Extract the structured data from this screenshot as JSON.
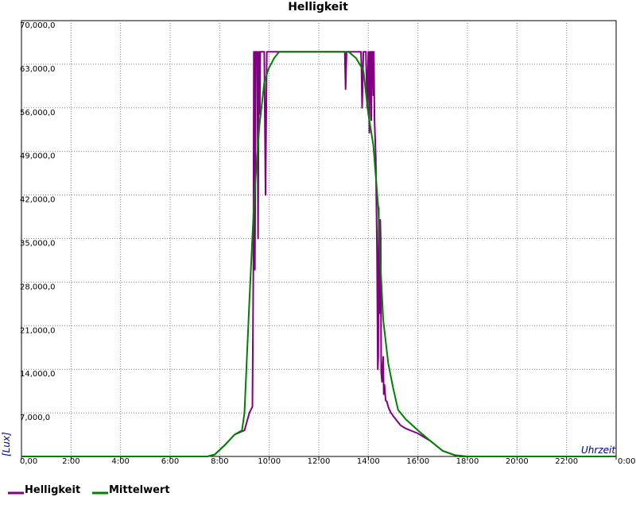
{
  "chart_data": {
    "type": "line",
    "title": "Helligkeit",
    "xlabel": "Uhrzeit",
    "ylabel": "[Lux]",
    "x_unit": "hours",
    "xlim": [
      0,
      24
    ],
    "ylim": [
      0,
      70000
    ],
    "x_ticks": [
      {
        "value": 0,
        "label": "0,00"
      },
      {
        "value": 2,
        "label": "2:00"
      },
      {
        "value": 4,
        "label": "4:00"
      },
      {
        "value": 6,
        "label": "6:00"
      },
      {
        "value": 8,
        "label": "8:00"
      },
      {
        "value": 10,
        "label": "10:00"
      },
      {
        "value": 12,
        "label": "12:00"
      },
      {
        "value": 14,
        "label": "14:00"
      },
      {
        "value": 16,
        "label": "16:00"
      },
      {
        "value": 18,
        "label": "18:00"
      },
      {
        "value": 20,
        "label": "20:00"
      },
      {
        "value": 22,
        "label": "22:00"
      },
      {
        "value": 24,
        "label": "0:00"
      }
    ],
    "y_ticks": [
      {
        "value": 7000,
        "label": "7,000,0"
      },
      {
        "value": 14000,
        "label": "14,000,0"
      },
      {
        "value": 21000,
        "label": "21,000,0"
      },
      {
        "value": 28000,
        "label": "28,000,0"
      },
      {
        "value": 35000,
        "label": "35,000,0"
      },
      {
        "value": 42000,
        "label": "42,000,0"
      },
      {
        "value": 49000,
        "label": "49,000,0"
      },
      {
        "value": 56000,
        "label": "56,000,0"
      },
      {
        "value": 63000,
        "label": "63,000,0"
      },
      {
        "value": 70000,
        "label": "70,000,0"
      }
    ],
    "grid": true,
    "legend_position": "bottom-left",
    "series": [
      {
        "name": "Helligkeit",
        "color": "#800080",
        "x": [
          0,
          7.5,
          7.8,
          8.2,
          8.6,
          9.0,
          9.2,
          9.32,
          9.36,
          9.38,
          9.4,
          9.42,
          9.44,
          9.46,
          9.5,
          9.52,
          9.55,
          9.58,
          9.6,
          9.62,
          9.64,
          9.66,
          9.7,
          9.75,
          9.8,
          9.85,
          9.9,
          9.92,
          9.95,
          9.98,
          10.0,
          10.02,
          10.05,
          10.1,
          10.2,
          13.0,
          13.05,
          13.08,
          13.12,
          13.2,
          13.35,
          13.5,
          13.6,
          13.7,
          13.72,
          13.75,
          13.8,
          13.9,
          13.95,
          14.0,
          14.02,
          14.04,
          14.06,
          14.08,
          14.1,
          14.12,
          14.14,
          14.16,
          14.18,
          14.2,
          14.22,
          14.25,
          14.3,
          14.35,
          14.38,
          14.4,
          14.42,
          14.45,
          14.48,
          14.5,
          14.52,
          14.55,
          14.6,
          14.62,
          14.65,
          14.7,
          14.75,
          14.8,
          14.85,
          14.88,
          14.9,
          14.92,
          15.0,
          15.1,
          15.2,
          15.3,
          15.5,
          16.0,
          16.5,
          17.0,
          17.5,
          17.7,
          18.0,
          24
        ],
        "values": [
          0,
          0,
          300,
          1800,
          3500,
          4200,
          7000,
          8000,
          30000,
          65000,
          65000,
          30000,
          45000,
          65000,
          65000,
          65000,
          35000,
          65000,
          65000,
          55000,
          65000,
          65000,
          65000,
          65000,
          65000,
          42000,
          65000,
          65000,
          65000,
          65000,
          65000,
          65000,
          65000,
          65000,
          65000,
          65000,
          65000,
          59000,
          65000,
          65000,
          65000,
          65000,
          65000,
          65000,
          63000,
          56000,
          65000,
          65000,
          56000,
          65000,
          59000,
          52000,
          65000,
          60000,
          65000,
          54000,
          65000,
          62000,
          65000,
          58000,
          65000,
          54000,
          48000,
          33000,
          14000,
          16000,
          40000,
          23000,
          38000,
          35000,
          13500,
          12000,
          16000,
          10000,
          11500,
          9000,
          8800,
          8000,
          7500,
          7300,
          7000,
          7000,
          6500,
          6000,
          5500,
          5000,
          4500,
          3700,
          2500,
          900,
          200,
          0,
          0,
          0
        ]
      },
      {
        "name": "Mittelwert",
        "color": "#008000",
        "x": [
          0,
          7.5,
          7.8,
          8.2,
          8.6,
          8.9,
          9.0,
          9.2,
          9.4,
          9.6,
          9.8,
          9.95,
          10.0,
          10.2,
          10.4,
          11.0,
          12.0,
          13.0,
          13.2,
          13.5,
          13.8,
          14.0,
          14.2,
          14.4,
          14.5,
          14.6,
          14.8,
          15.0,
          15.2,
          15.5,
          16.0,
          16.5,
          17.0,
          17.5,
          18.0,
          24
        ],
        "values": [
          0,
          0,
          300,
          1800,
          3500,
          4200,
          7000,
          25000,
          42000,
          53000,
          60000,
          62000,
          62500,
          64000,
          65000,
          65000,
          65000,
          65000,
          65000,
          64000,
          62000,
          55000,
          50000,
          40000,
          30000,
          22000,
          15000,
          11000,
          7500,
          6000,
          4200,
          2500,
          900,
          200,
          0,
          0
        ]
      }
    ]
  }
}
